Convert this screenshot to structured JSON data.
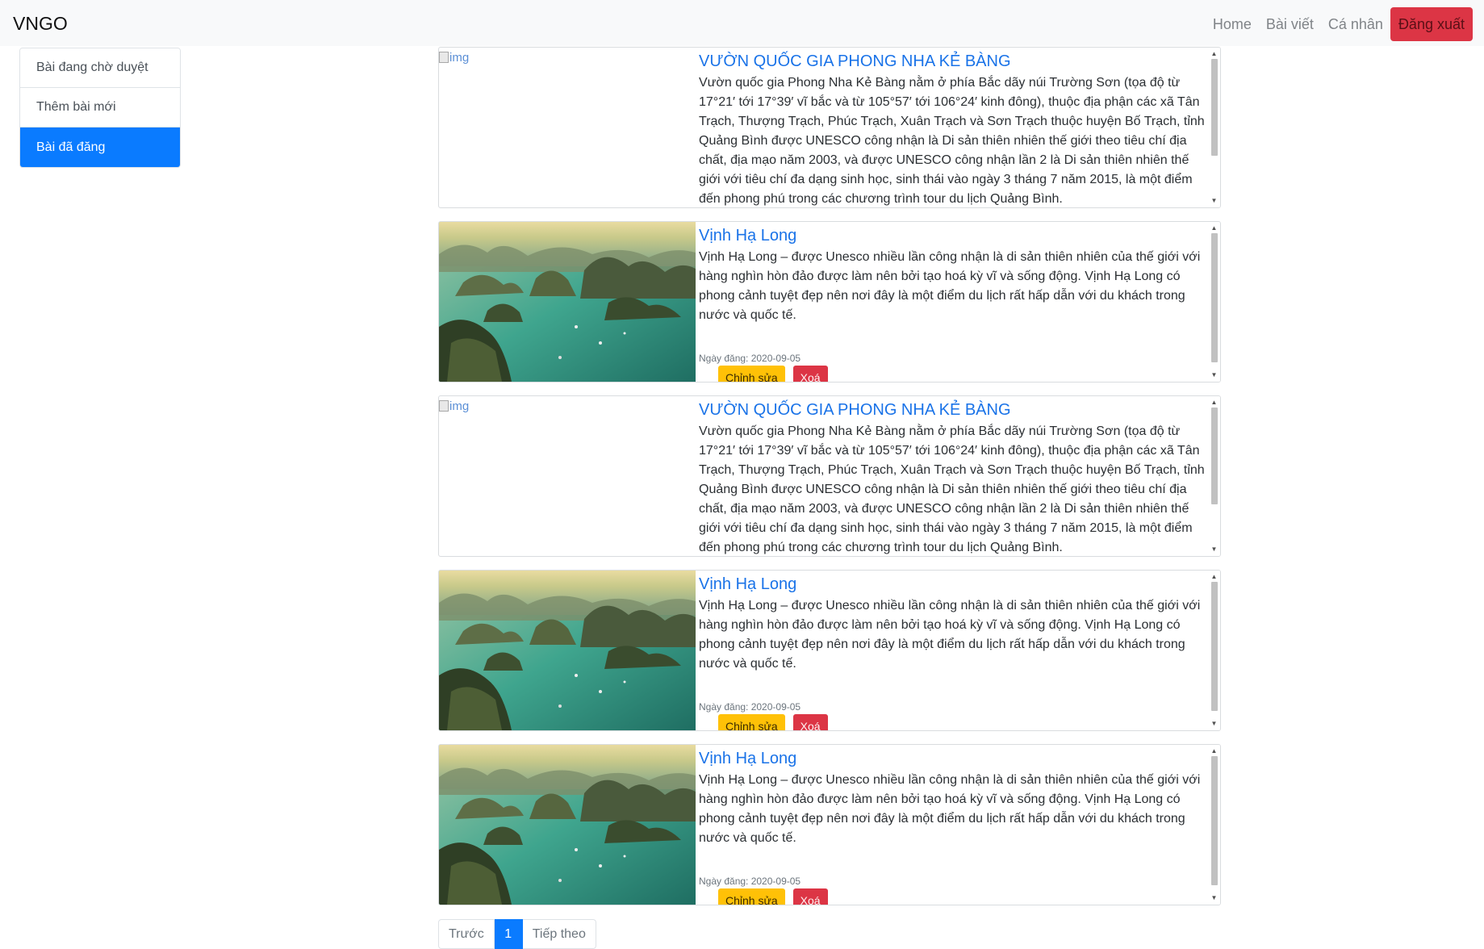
{
  "navbar": {
    "brand": "VNGO",
    "links": [
      "Home",
      "Bài viết",
      "Cá nhân"
    ],
    "logout": "Đăng xuất"
  },
  "sidebar": {
    "items": [
      {
        "label": "Bài đang chờ duyệt",
        "active": false
      },
      {
        "label": "Thêm bài mới",
        "active": false
      },
      {
        "label": "Bài đã đăng",
        "active": true
      }
    ]
  },
  "posts": [
    {
      "image": "broken",
      "image_alt": "img",
      "title": "VƯỜN QUỐC GIA PHONG NHA KẺ BÀNG",
      "description": "Vườn quốc gia Phong Nha Kẻ Bàng nằm ở phía Bắc dãy núi Trường Sơn (tọa độ từ 17°21′ tới 17°39′ vĩ bắc và từ 105°57′ tới 106°24′ kinh đông), thuộc địa phận các xã Tân Trạch, Thượng Trạch, Phúc Trạch, Xuân Trạch và Sơn Trạch thuộc huyện Bố Trạch, tỉnh Quảng Bình được UNESCO công nhận là Di sản thiên nhiên thế giới theo tiêu chí địa chất, địa mạo năm 2003, và được UNESCO công nhận lần 2 là Di sản thiên nhiên thế giới với tiêu chí đa dạng sinh học, sinh thái vào ngày 3 tháng 7 năm 2015, là một điểm đến phong phú trong các chương trình tour du lịch Quảng Bình.",
      "date": "",
      "edit": "",
      "delete": ""
    },
    {
      "image": "halong-bay-photo",
      "image_alt": "",
      "title": "Vịnh Hạ Long",
      "description": "Vịnh Hạ Long – được Unesco nhiều lần công nhận là di sản thiên nhiên của thế giới với hàng nghìn hòn đảo được làm nên bởi tạo hoá kỳ vĩ và sống động. Vịnh Hạ Long có phong cảnh tuyệt đẹp nên nơi đây là một điểm du lịch rất hấp dẫn với du khách trong nước và quốc tế.",
      "date": "Ngày đăng: 2020-09-05",
      "edit": "Chỉnh sửa",
      "delete": "Xoá"
    },
    {
      "image": "broken",
      "image_alt": "img",
      "title": "VƯỜN QUỐC GIA PHONG NHA KẺ BÀNG",
      "description": "Vườn quốc gia Phong Nha Kẻ Bàng nằm ở phía Bắc dãy núi Trường Sơn (tọa độ từ 17°21′ tới 17°39′ vĩ bắc và từ 105°57′ tới 106°24′ kinh đông), thuộc địa phận các xã Tân Trạch, Thượng Trạch, Phúc Trạch, Xuân Trạch và Sơn Trạch thuộc huyện Bố Trạch, tỉnh Quảng Bình được UNESCO công nhận là Di sản thiên nhiên thế giới theo tiêu chí địa chất, địa mạo năm 2003, và được UNESCO công nhận lần 2 là Di sản thiên nhiên thế giới với tiêu chí đa dạng sinh học, sinh thái vào ngày 3 tháng 7 năm 2015, là một điểm đến phong phú trong các chương trình tour du lịch Quảng Bình.",
      "date": "",
      "edit": "",
      "delete": ""
    },
    {
      "image": "halong-bay-photo",
      "image_alt": "",
      "title": "Vịnh Hạ Long",
      "description": "Vịnh Hạ Long – được Unesco nhiều lần công nhận là di sản thiên nhiên của thế giới với hàng nghìn hòn đảo được làm nên bởi tạo hoá kỳ vĩ và sống động. Vịnh Hạ Long có phong cảnh tuyệt đẹp nên nơi đây là một điểm du lịch rất hấp dẫn với du khách trong nước và quốc tế.",
      "date": "Ngày đăng: 2020-09-05",
      "edit": "Chỉnh sửa",
      "delete": "Xoá"
    },
    {
      "image": "halong-bay-photo",
      "image_alt": "",
      "title": "Vịnh Hạ Long",
      "description": "Vịnh Hạ Long – được Unesco nhiều lần công nhận là di sản thiên nhiên của thế giới với hàng nghìn hòn đảo được làm nên bởi tạo hoá kỳ vĩ và sống động. Vịnh Hạ Long có phong cảnh tuyệt đẹp nên nơi đây là một điểm du lịch rất hấp dẫn với du khách trong nước và quốc tế.",
      "date": "Ngày đăng: 2020-09-05",
      "edit": "Chỉnh sửa",
      "delete": "Xoá"
    }
  ],
  "pagination": {
    "prev": "Trước",
    "current": "1",
    "next": "Tiếp theo"
  },
  "colors": {
    "primary": "#0a7bff",
    "danger": "#dc3545",
    "warning": "#ffc107",
    "link": "#1a73e8"
  }
}
